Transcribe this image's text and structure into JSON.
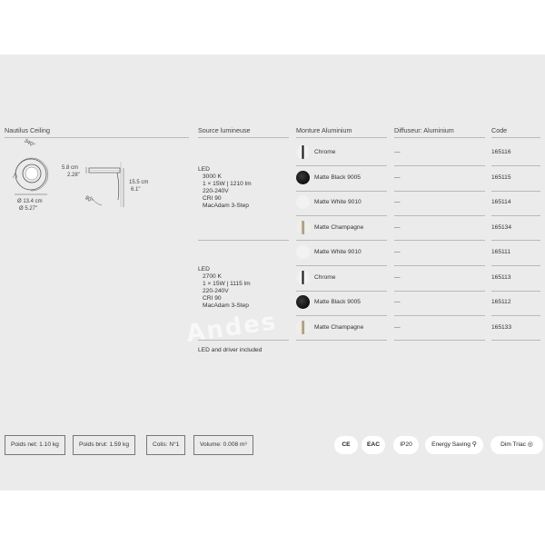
{
  "headers": {
    "product": "Nautilus Ceiling",
    "source": "Source lumineuse",
    "frame": "Monture Aluminium",
    "diffuser": "Diffuseur: Aluminium",
    "code": "Code"
  },
  "dimensions": {
    "rotation": "340°",
    "tilt": "90°",
    "diameter_cm": "Ø 13.4 cm",
    "diameter_in": "Ø 5.27\"",
    "height_cm": "5.8 cm",
    "height_in": "2.28\"",
    "length_cm": "15.5 cm",
    "length_in": "6.1\""
  },
  "groups": [
    {
      "type": "LED",
      "specs": [
        "3000 K",
        "1 × 15W | 1210 lm",
        "220-240V",
        "CRI 90",
        "MacAdam 3-Step"
      ],
      "rows": [
        {
          "finish": "Chrome",
          "swatch": "chrome",
          "diffuser": "—",
          "code": "165116"
        },
        {
          "finish": "Matte Black 9005",
          "swatch": "black",
          "diffuser": "—",
          "code": "165115"
        },
        {
          "finish": "Matte White 9010",
          "swatch": "white",
          "diffuser": "—",
          "code": "165114"
        },
        {
          "finish": "Matte Champagne",
          "swatch": "champ",
          "diffuser": "—",
          "code": "165134"
        }
      ]
    },
    {
      "type": "LED",
      "specs": [
        "2700 K",
        "1 × 15W | 1115 lm",
        "220-240V",
        "CRI 90",
        "MacAdam 3-Step"
      ],
      "rows": [
        {
          "finish": "Matte White 9010",
          "swatch": "white",
          "diffuser": "—",
          "code": "165111"
        },
        {
          "finish": "Chrome",
          "swatch": "chrome",
          "diffuser": "—",
          "code": "165113"
        },
        {
          "finish": "Matte Black 9005",
          "swatch": "black",
          "diffuser": "—",
          "code": "165112"
        },
        {
          "finish": "Matte Champagne",
          "swatch": "champ",
          "diffuser": "—",
          "code": "165133"
        }
      ]
    }
  ],
  "footnote": "LED and driver included",
  "watermark": "Andes",
  "packaging": {
    "net_weight": "Poids net: 1.10 kg",
    "gross_weight": "Poids brut: 1.59 kg",
    "parcels": "Colis: N°1",
    "volume": "Volume: 0.008 m³"
  },
  "certifications": {
    "ce": "CE",
    "eac": "EAC",
    "ip": "IP20",
    "energy": "Energy Saving",
    "dim": "Dim Triac"
  }
}
